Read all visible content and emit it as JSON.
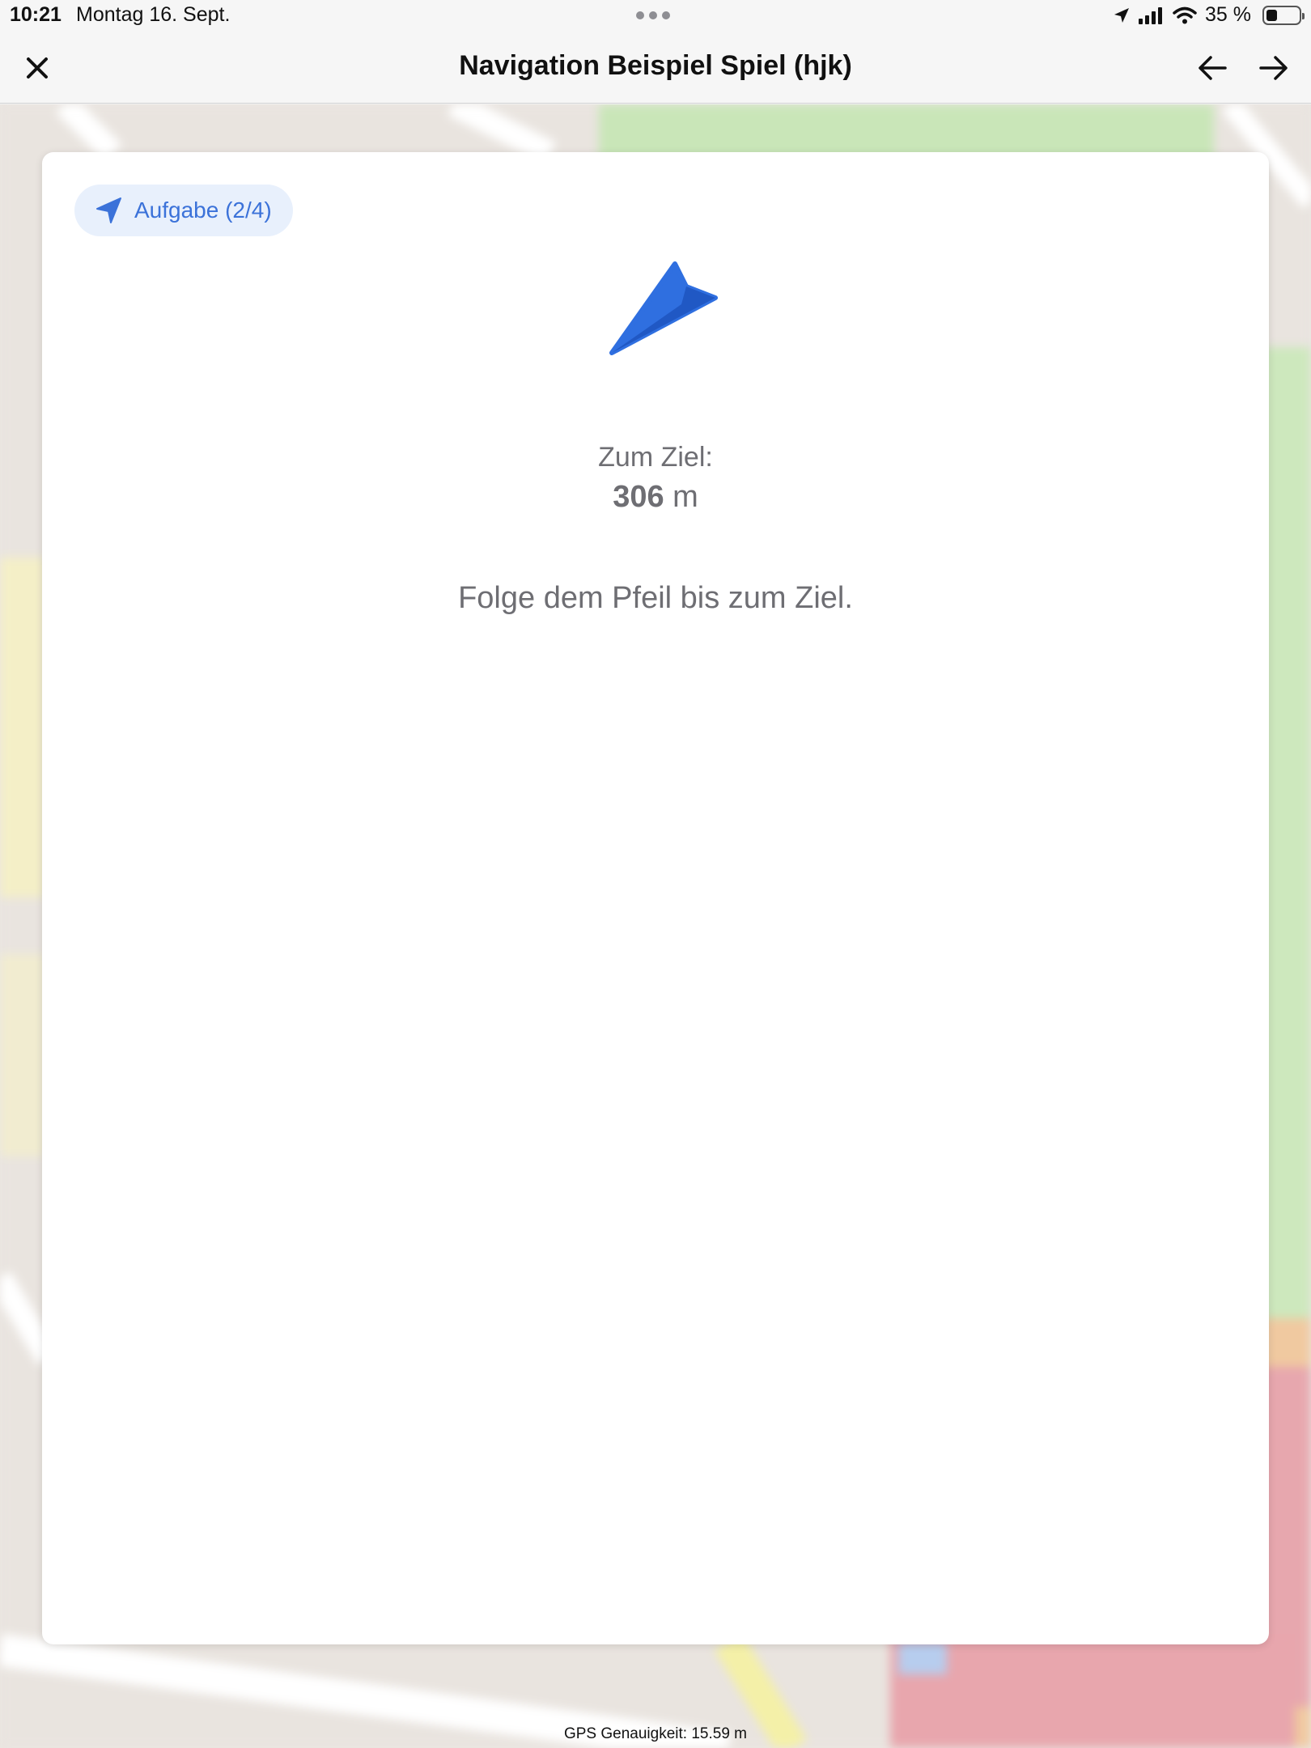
{
  "status_bar": {
    "time": "10:21",
    "date": "Montag 16. Sept.",
    "battery": "35 %"
  },
  "nav": {
    "title": "Navigation Beispiel Spiel (hjk)",
    "close_icon": "close-icon",
    "back_icon": "arrow-left-icon",
    "forward_icon": "arrow-right-icon"
  },
  "card": {
    "task_chip": "Aufgabe (2/4)",
    "distance_label": "Zum Ziel:",
    "distance_value": "306",
    "distance_unit": "m",
    "instruction": "Folge dem Pfeil bis zum Ziel."
  },
  "footer": {
    "gps_accuracy": "GPS Genauigkeit: 15.59 m"
  },
  "colors": {
    "accent": "#3b72d9",
    "arrow": "#2f6fe0",
    "chip_bg": "#e8f0fc",
    "text_muted": "#6e6e73"
  }
}
